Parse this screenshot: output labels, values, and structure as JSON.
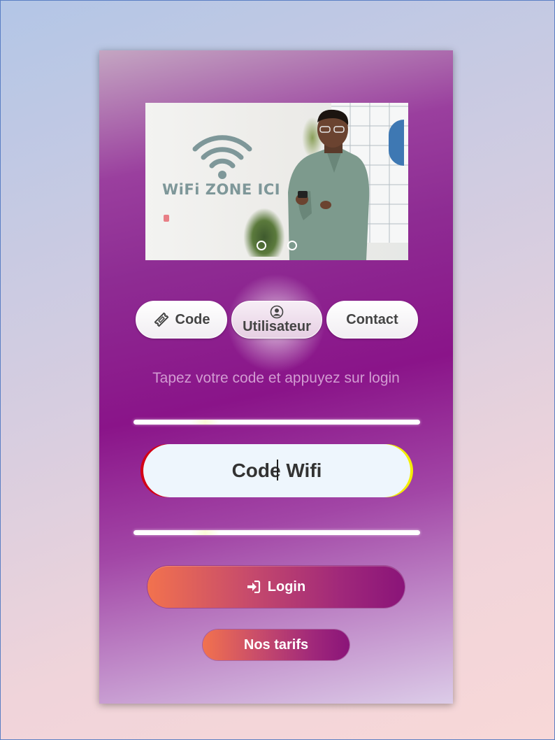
{
  "slider": {
    "banner_text": "WiFi ZONE ICI",
    "slide_count": 2
  },
  "tabs": [
    {
      "label": "Code",
      "icon": "ticket-icon"
    },
    {
      "label": "Utilisateur",
      "icon": "user-circle-icon"
    },
    {
      "label": "Contact",
      "icon": ""
    }
  ],
  "hint": "Tapez votre code et appuyez sur login",
  "code_field": {
    "placeholder": "Code Wifi",
    "value": ""
  },
  "login_button": {
    "label": "Login",
    "icon": "sign-in-icon"
  },
  "tarifs_button": {
    "label": "Nos tarifs"
  },
  "colors": {
    "accent_start": "#f2724e",
    "accent_end": "#8a1479",
    "card_purple": "#8a1489",
    "field_bg": "#eef6fd",
    "hint_text": "#d29bd2"
  }
}
